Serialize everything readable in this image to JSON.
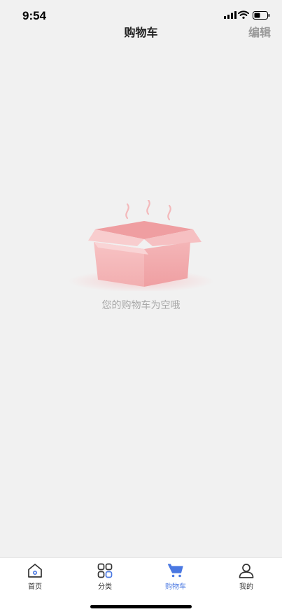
{
  "status_bar": {
    "time": "9:54",
    "icons": [
      "cellular-signal-icon",
      "wifi-icon",
      "battery-icon"
    ]
  },
  "nav": {
    "title": "购物车",
    "edit_label": "编辑"
  },
  "empty_state": {
    "illustration": "open-box-icon",
    "message": "您的购物车为空哦"
  },
  "tab_bar": {
    "active": "购物车",
    "tabs": [
      {
        "label": "首页",
        "icon": "home-icon"
      },
      {
        "label": "分类",
        "icon": "category-grid-icon"
      },
      {
        "label": "购物车",
        "icon": "cart-icon"
      },
      {
        "label": "我的",
        "icon": "user-icon"
      }
    ]
  },
  "colors": {
    "background": "#f1f1f1",
    "accent": "#4a78e2",
    "box_pink": "#f4b7b9",
    "muted_text": "#a8a8a8"
  }
}
